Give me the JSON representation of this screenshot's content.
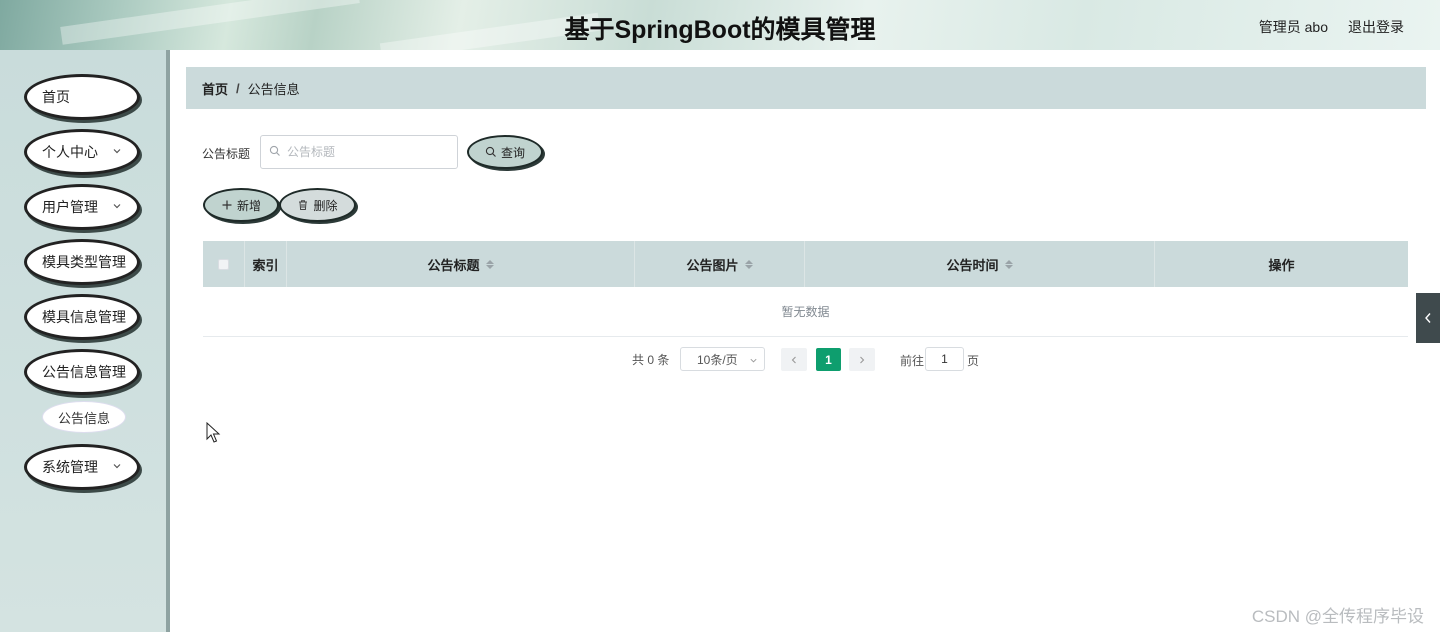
{
  "header": {
    "title": "基于SpringBoot的模具管理",
    "user": "管理员 abo",
    "logout": "退出登录"
  },
  "sidebar": {
    "items": [
      {
        "label": "首页",
        "has_children": false
      },
      {
        "label": "个人中心",
        "has_children": true
      },
      {
        "label": "用户管理",
        "has_children": true
      },
      {
        "label": "模具类型管理",
        "has_children": true
      },
      {
        "label": "模具信息管理",
        "has_children": true
      },
      {
        "label": "公告信息管理",
        "has_children": true,
        "expanded": true
      },
      {
        "label": "系统管理",
        "has_children": true
      }
    ],
    "submenu": {
      "label": "公告信息"
    }
  },
  "breadcrumb": {
    "home": "首页",
    "separator": "/",
    "current": "公告信息"
  },
  "search": {
    "label": "公告标题",
    "placeholder": "公告标题",
    "value": "",
    "button": "查询"
  },
  "actions": {
    "add": "新增",
    "delete": "删除"
  },
  "table": {
    "columns": [
      {
        "label": "",
        "type": "checkbox"
      },
      {
        "label": "索引",
        "sortable": false
      },
      {
        "label": "公告标题",
        "sortable": true
      },
      {
        "label": "公告图片",
        "sortable": true
      },
      {
        "label": "公告时间",
        "sortable": true
      },
      {
        "label": "操作",
        "sortable": false
      }
    ],
    "rows": [],
    "empty_text": "暂无数据"
  },
  "pagination": {
    "total_text": "共 0 条",
    "page_size": "10条/页",
    "current_page": "1",
    "goto_label": "前往",
    "goto_value": "1",
    "goto_suffix": "页"
  },
  "watermark": "CSDN @全传程序毕设",
  "colors": {
    "accent_green": "#0e9e6e",
    "table_header": "#cbdadb",
    "sidebar_bg": "#cfe0df"
  }
}
